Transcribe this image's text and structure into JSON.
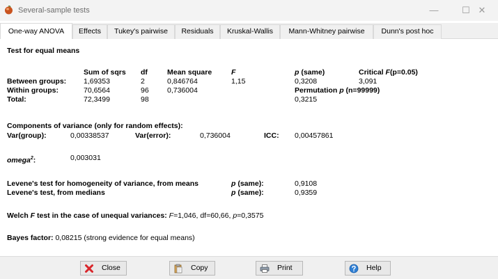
{
  "window": {
    "title": "Several-sample tests",
    "minimize_glyph": "—",
    "maximize_glyph": "☐",
    "close_glyph": "✕"
  },
  "tabs": [
    {
      "label": "One-way ANOVA",
      "active": true
    },
    {
      "label": "Effects"
    },
    {
      "label": "Tukey's pairwise"
    },
    {
      "label": "Residuals"
    },
    {
      "label": "Kruskal-Wallis"
    },
    {
      "label": "Mann-Whitney pairwise"
    },
    {
      "label": "Dunn's post hoc"
    }
  ],
  "report": {
    "heading": "Test for equal means",
    "headers": {
      "ss": "Sum of sqrs",
      "df": "df",
      "ms": "Mean square",
      "f": "F",
      "p_sym": "p",
      "p_rest": " (same)",
      "crit_pre": "Critical ",
      "crit_f": "F",
      "crit_post": "(p=0.05)"
    },
    "rows": [
      {
        "label": "Between groups:",
        "ss": "1,69353",
        "df": "2",
        "ms": "0,846764",
        "f": "1,15",
        "p": "0,3208",
        "crit": "3,091"
      },
      {
        "label": "Within groups:",
        "ss": "70,6564",
        "df": "96",
        "ms": "0,736004"
      },
      {
        "label": "Total:",
        "ss": "72,3499",
        "df": "98",
        "p": "0,3215"
      }
    ],
    "permutation": {
      "pre": "Permutation ",
      "p": "p",
      "post": " (n=99999)"
    },
    "components": {
      "heading": "Components of variance (only for random effects):",
      "var_group_label": "Var(group):",
      "var_group": "0,00338537",
      "var_error_label": "Var(error):",
      "var_error": "0,736004",
      "icc_label": "ICC:",
      "icc": "0,00457861"
    },
    "omega": {
      "label": "omega",
      "sup": "2",
      "colon": ":",
      "value": "0,003031"
    },
    "levene": {
      "means_label": "Levene's test for homogeneity of variance, from means",
      "medians_label": "Levene's test, from medians",
      "p_sym": "p",
      "p_rest": " (same):",
      "means_p": "0,9108",
      "medians_p": "0,9359"
    },
    "welch": {
      "pre": "Welch ",
      "f": "F",
      "post": " test in the case of unequal variances: ",
      "f_inline": "F",
      "stats": "=1,046, df=60,66, ",
      "p": "p",
      "p_val": "=0,3575"
    },
    "bayes": {
      "label": "Bayes factor:",
      "value": " 0,08215 (strong evidence for equal means)"
    }
  },
  "footer": {
    "close": "Close",
    "copy": "Copy",
    "print": "Print",
    "help": "Help"
  },
  "colors": {
    "close_icon": "#d9262b",
    "help_icon": "#2f7fd4",
    "app_icon": "#c9531f"
  }
}
